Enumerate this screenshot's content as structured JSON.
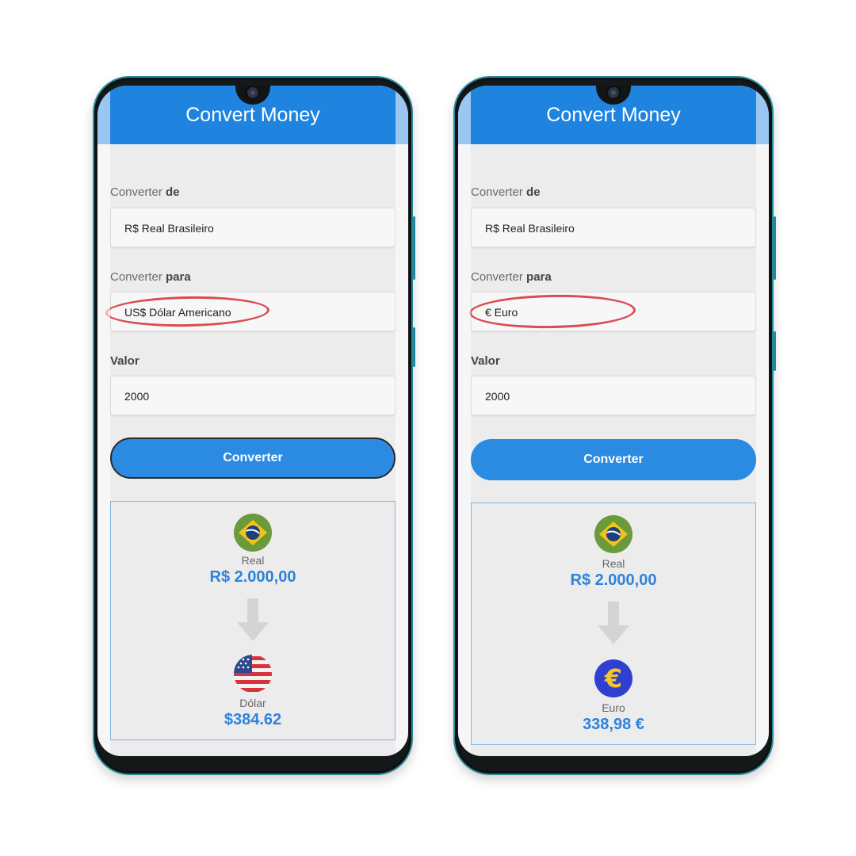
{
  "screens": [
    {
      "title": "Convert Money",
      "from_label": "Converter",
      "from_label_bold": "de",
      "from_value": "R$ Real Brasileiro",
      "to_label": "Converter",
      "to_label_bold": "para",
      "to_value": "US$ Dólar Americano",
      "amount_label": "Valor",
      "amount_value": "2000",
      "button_label": "Converter",
      "source_name": "Real",
      "source_amount": "R$ 2.000,00",
      "target_name": "Dólar",
      "target_amount": "$384.62"
    },
    {
      "title": "Convert Money",
      "from_label": "Converter",
      "from_label_bold": "de",
      "from_value": "R$ Real Brasileiro",
      "to_label": "Converter",
      "to_label_bold": "para",
      "to_value": "€ Euro",
      "amount_label": "Valor",
      "amount_value": "2000",
      "button_label": "Converter",
      "source_name": "Real",
      "source_amount": "R$ 2.000,00",
      "target_name": "Euro",
      "target_amount": "338,98 €",
      "euro_symbol": "€"
    }
  ],
  "icons": {
    "source_flag": "brazil-flag-icon",
    "target_flag_left": "usa-flag-icon",
    "target_flag_right": "euro-coin-icon",
    "arrow": "arrow-down-icon"
  },
  "colors": {
    "header": "#1e84e0",
    "button": "#2b8ae2",
    "amount_text": "#2e83da",
    "annotation_circle": "#d94c52"
  }
}
